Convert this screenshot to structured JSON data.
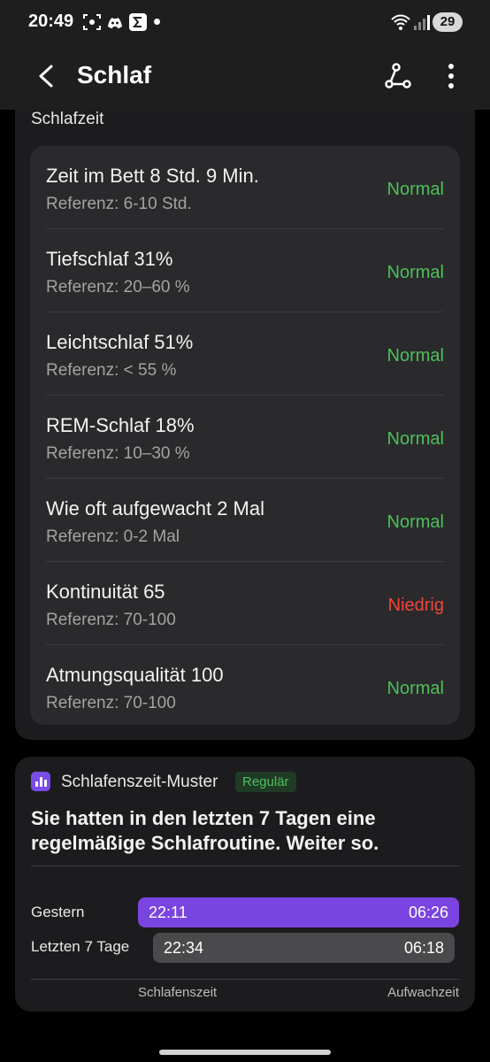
{
  "status_bar": {
    "time": "20:49",
    "battery": "29",
    "icons": [
      "screenshot-icon",
      "discord-icon",
      "sigma-app-icon",
      "notification-dot-icon",
      "wifi-icon",
      "signal-icon",
      "battery-icon"
    ]
  },
  "header": {
    "title": "Schlaf",
    "back_icon": "back-arrow-icon",
    "share_icon": "share-icon",
    "more_icon": "more-vert-icon"
  },
  "sleep_section": {
    "title": "Schlafzeit",
    "rows": [
      {
        "title": "Zeit im Bett 8 Std. 9 Min.",
        "reference": "Referenz: 6-10 Std.",
        "status": "Normal",
        "status_color": "#4cc05a"
      },
      {
        "title": "Tiefschlaf 31%",
        "reference": "Referenz: 20–60 %",
        "status": "Normal",
        "status_color": "#4cc05a"
      },
      {
        "title": "Leichtschlaf 51%",
        "reference": "Referenz: < 55 %",
        "status": "Normal",
        "status_color": "#4cc05a"
      },
      {
        "title": "REM-Schlaf 18%",
        "reference": "Referenz: 10–30 %",
        "status": "Normal",
        "status_color": "#4cc05a"
      },
      {
        "title": "Wie oft aufgewacht 2 Mal",
        "reference": "Referenz: 0-2 Mal",
        "status": "Normal",
        "status_color": "#4cc05a"
      },
      {
        "title": "Kontinuität 65",
        "reference": "Referenz: 70-100",
        "status": "Niedrig",
        "status_color": "#f0463c"
      },
      {
        "title": "Atmungsqualität 100",
        "reference": "Referenz: 70-100",
        "status": "Normal",
        "status_color": "#4cc05a"
      }
    ]
  },
  "pattern_section": {
    "icon": "bar-chart-icon",
    "title": "Schlafenszeit-Muster",
    "badge": "Regulär",
    "description": "Sie hatten in den letzten 7 Tagen eine regelmäßige Schlafroutine. Weiter so.",
    "bars": [
      {
        "label": "Gestern",
        "start": "22:11",
        "end": "06:26",
        "color": "#7a44e0"
      },
      {
        "label": "Letzten 7 Tage",
        "start": "22:34",
        "end": "06:18",
        "color": "#4a4a4c"
      }
    ],
    "axis_start_label": "Schlafenszeit",
    "axis_end_label": "Aufwachzeit"
  }
}
